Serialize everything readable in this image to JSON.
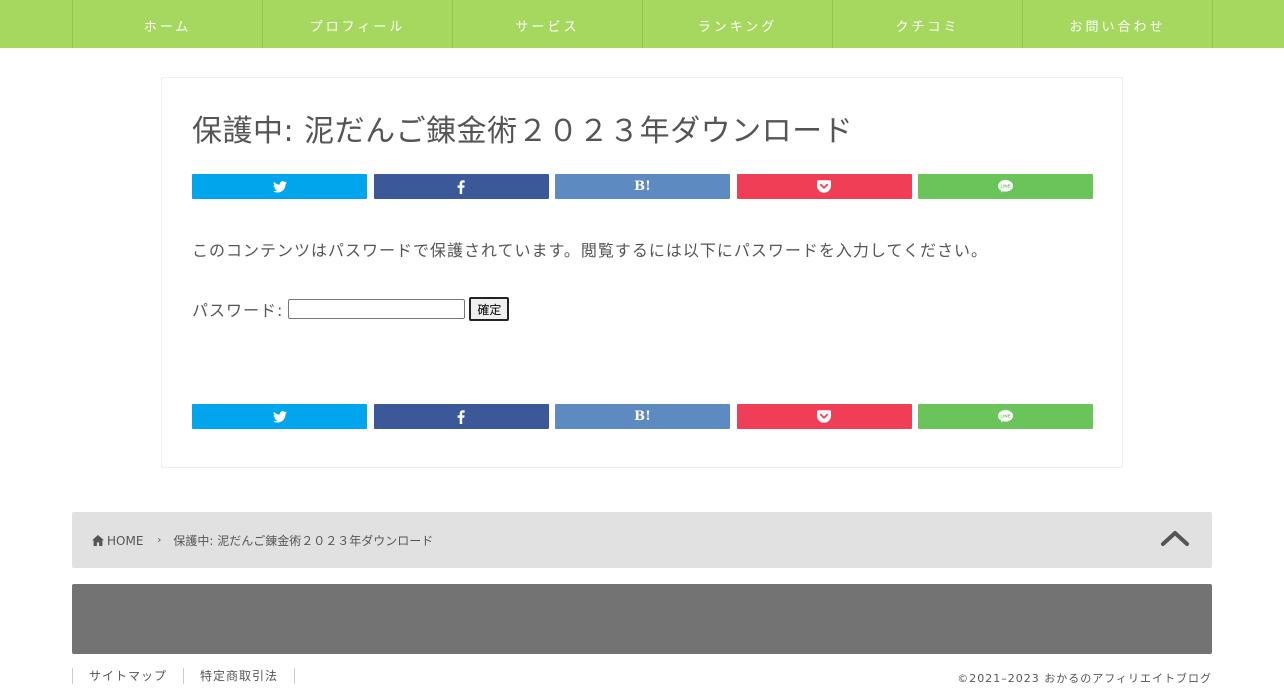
{
  "nav": {
    "items": [
      {
        "label": "ホーム"
      },
      {
        "label": "プロフィール"
      },
      {
        "label": "サービス"
      },
      {
        "label": "ランキング"
      },
      {
        "label": "クチコミ"
      },
      {
        "label": "お問い合わせ"
      }
    ]
  },
  "article": {
    "title": "保護中: 泥だんご錬金術２０２３年ダウンロード",
    "protected_message": "このコンテンツはパスワードで保護されています。閲覧するには以下にパスワードを入力してください。",
    "password_label": "パスワード:",
    "password_value": "",
    "submit_label": "確定"
  },
  "share": {
    "buttons": [
      {
        "service": "twitter",
        "icon": "twitter-icon",
        "color": "#00a5ec"
      },
      {
        "service": "facebook",
        "icon": "facebook-icon",
        "color": "#3b5998"
      },
      {
        "service": "hatena",
        "label": "B!",
        "color": "#5d8ac1"
      },
      {
        "service": "pocket",
        "icon": "pocket-icon",
        "color": "#ef3e56"
      },
      {
        "service": "line",
        "icon": "line-icon",
        "color": "#6ac45a"
      }
    ]
  },
  "breadcrumb": {
    "home_label": "HOME",
    "current": "保護中: 泥だんご錬金術２０２３年ダウンロード"
  },
  "footer": {
    "links": [
      {
        "label": "サイトマップ"
      },
      {
        "label": "特定商取引法"
      }
    ],
    "copyright": "©2021–2023  おかるのアフィリエイトブログ"
  },
  "colors": {
    "nav_bg": "#a6d85f",
    "breadcrumb_bg": "#e1e1e1",
    "footer_bg": "#737373"
  }
}
